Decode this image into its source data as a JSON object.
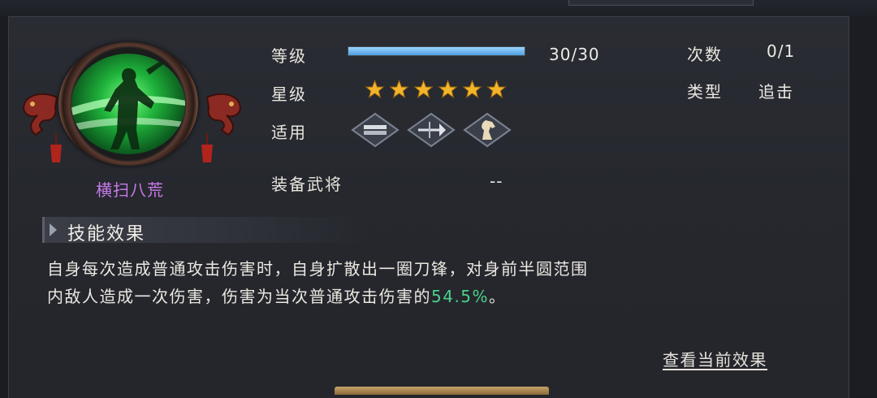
{
  "skill": {
    "name": "横扫八荒",
    "emblem_icon": "green-warrior-skill-icon"
  },
  "info": {
    "level_label": "等级",
    "level_value": "30/30",
    "level_progress": 1.0,
    "star_label": "星级",
    "star_count": 6,
    "apply_label": "适用",
    "apply_units": [
      "shield-troop-icon",
      "spear-troop-icon",
      "cavalry-horse-icon"
    ],
    "equip_label": "装备武将",
    "equip_value": "--",
    "count_label": "次数",
    "count_value": "0/1",
    "type_label": "类型",
    "type_value": "追击"
  },
  "effect": {
    "section_title": "技能效果",
    "description_line1": "自身每次造成普通攻击伤害时，自身扩散出一圈刀锋，对身前半圆范围",
    "description_line2_prefix": "内敌人造成一次伤害，伤害为当次普通攻击伤害的",
    "description_highlight": "54.5%",
    "description_suffix": "。",
    "highlight_color": "#4bd08a",
    "view_current_link": "查看当前效果"
  },
  "colors": {
    "skill_name": "#c77ae8",
    "level_bar": "#6fb8f0",
    "star": "#f2b52a"
  }
}
